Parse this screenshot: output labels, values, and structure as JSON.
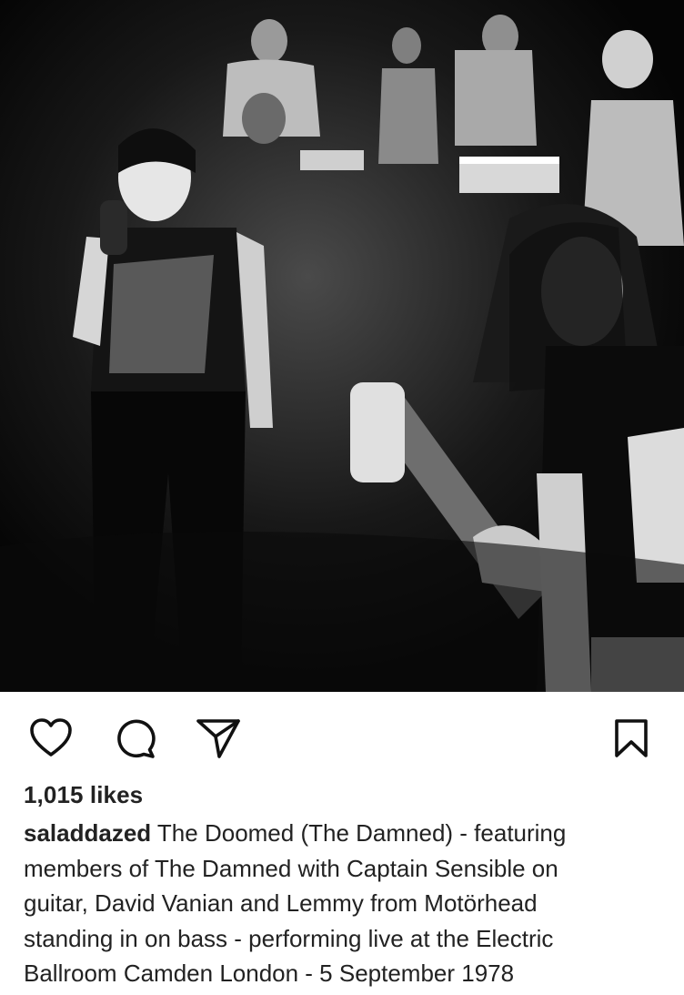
{
  "post": {
    "image_icon": "concert-photo",
    "likes_text": "1,015 likes",
    "username": "saladdazed",
    "caption_lines": [
      " The Doomed (The Damned) - featuring",
      "members of The Damned with Captain Sensible on",
      "guitar, David Vanian and Lemmy from Motörhead",
      "standing in on bass - performing live at the Electric",
      "Ballroom Camden London - 5 September 1978"
    ]
  },
  "actions": {
    "like_icon": "heart-icon",
    "comment_icon": "comment-icon",
    "share_icon": "share-icon",
    "save_icon": "bookmark-icon"
  },
  "colors": {
    "text": "#222222",
    "background": "#ffffff",
    "icon": "#111111"
  }
}
